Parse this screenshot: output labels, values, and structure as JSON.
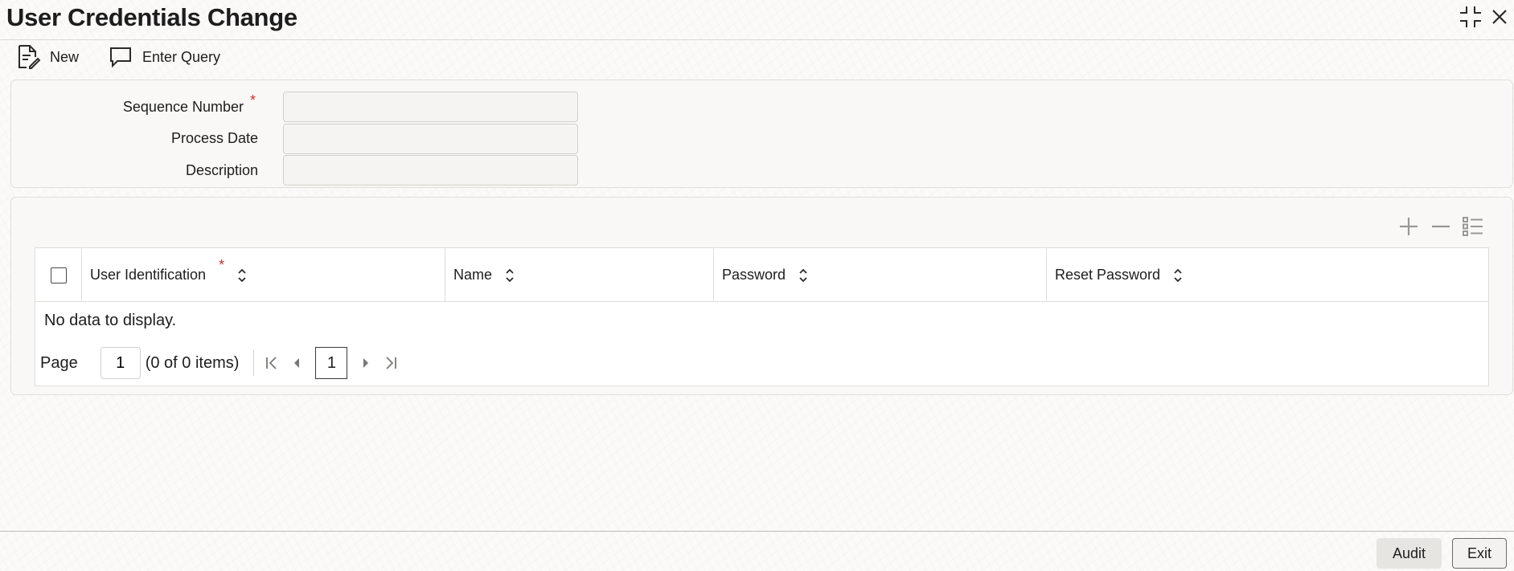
{
  "window": {
    "title": "User Credentials Change",
    "icons": {
      "maximize": "maximize-icon",
      "close": "close-icon"
    }
  },
  "toolbar": {
    "new_label": "New",
    "enter_query_label": "Enter Query",
    "icons": {
      "new": "new-document-icon",
      "enter_query": "chat-bubble-icon"
    }
  },
  "form": {
    "sequence_number": {
      "label": "Sequence Number",
      "required_mark": "*",
      "value": ""
    },
    "process_date": {
      "label": "Process Date",
      "value": ""
    },
    "description": {
      "label": "Description",
      "value": ""
    }
  },
  "grid": {
    "actions": {
      "add": "plus-icon",
      "remove": "minus-icon",
      "view": "list-icon"
    },
    "columns": [
      {
        "label": "User Identification",
        "required_mark": "*"
      },
      {
        "label": "Name"
      },
      {
        "label": "Password"
      },
      {
        "label": "Reset Password"
      }
    ],
    "empty_message": "No data to display.",
    "pagination": {
      "page_label": "Page",
      "page_value": "1",
      "items_text": "(0 of 0 items)",
      "current_page": "1"
    }
  },
  "footer": {
    "audit_label": "Audit",
    "exit_label": "Exit"
  },
  "colors": {
    "required": "#c0362c",
    "border": "#dfddd9",
    "panel_bg": "#f8f7f5"
  }
}
